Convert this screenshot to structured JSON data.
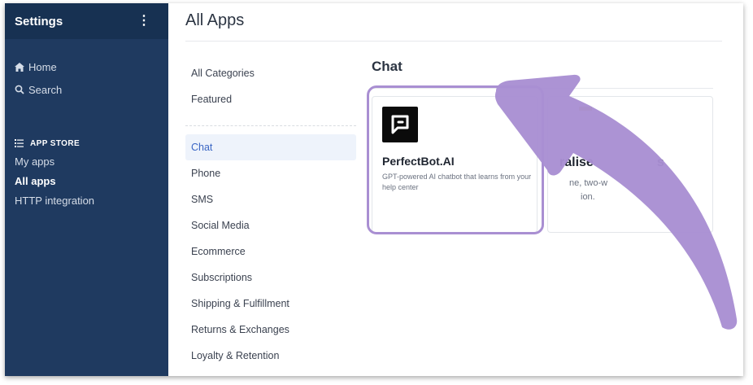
{
  "sidebar": {
    "title": "Settings",
    "menu_glyph": "⋮",
    "nav": [
      {
        "icon": "home-icon",
        "label": "Home"
      },
      {
        "icon": "search-icon",
        "label": "Search"
      }
    ],
    "store_heading": "APP STORE",
    "store_items": [
      {
        "label": "My apps",
        "active": false
      },
      {
        "label": "All apps",
        "active": true
      },
      {
        "label": "HTTP integration",
        "active": false
      }
    ]
  },
  "main": {
    "title": "All Apps",
    "categories": {
      "top": [
        "All Categories",
        "Featured"
      ],
      "list": [
        "Chat",
        "Phone",
        "SMS",
        "Social Media",
        "Ecommerce",
        "Subscriptions",
        "Shipping & Fulfillment",
        "Returns & Exchanges",
        "Loyalty & Retention"
      ],
      "selected": "Chat"
    },
    "section_title": "Chat",
    "cards": [
      {
        "name": "PerfectBot.AI",
        "description": "GPT-powered AI chatbot that learns from your help center",
        "logo": "perfectbot-logo"
      },
      {
        "name": "ralise",
        "name_tail": "s",
        "description": "ne, two-w",
        "description_2": "ion."
      }
    ]
  },
  "colors": {
    "sidebar_bg": "#1f3a60",
    "sidebar_header_bg": "#173152",
    "accent_blue": "#3b66c4",
    "highlight_purple": "#a98fd2"
  }
}
